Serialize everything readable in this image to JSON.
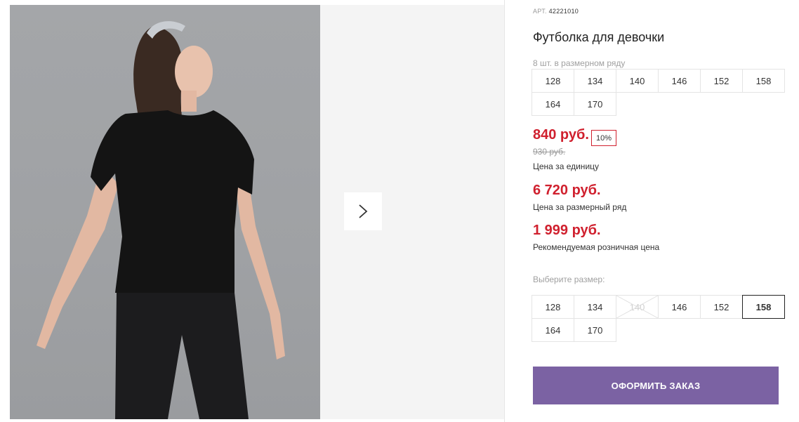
{
  "product": {
    "article_label": "АРТ.",
    "article_value": "42221010",
    "title": "Футболка для девочки"
  },
  "pack": {
    "label": "8 шт. в размерном ряду",
    "sizes": [
      "128",
      "134",
      "140",
      "146",
      "152",
      "158",
      "164",
      "170"
    ]
  },
  "pricing": {
    "unit_price": "840 руб.",
    "discount": "10%",
    "old_price": "930 руб.",
    "unit_caption": "Цена за единицу",
    "set_price": "6 720 руб.",
    "set_caption": "Цена за размерный ряд",
    "retail_price": "1 999 руб.",
    "retail_caption": "Рекомендуемая розничная цена",
    "accent_color": "#d0202e"
  },
  "size_select": {
    "label": "Выберите размер:",
    "sizes": [
      {
        "label": "128",
        "state": "available"
      },
      {
        "label": "134",
        "state": "available"
      },
      {
        "label": "140",
        "state": "unavailable"
      },
      {
        "label": "146",
        "state": "available"
      },
      {
        "label": "152",
        "state": "available"
      },
      {
        "label": "158",
        "state": "selected"
      },
      {
        "label": "164",
        "state": "available"
      },
      {
        "label": "170",
        "state": "available"
      }
    ]
  },
  "actions": {
    "order_label": "ОФОРМИТЬ ЗАКАЗ",
    "order_color": "#7b62a3"
  },
  "gallery": {
    "next_icon": "chevron-right-icon"
  }
}
